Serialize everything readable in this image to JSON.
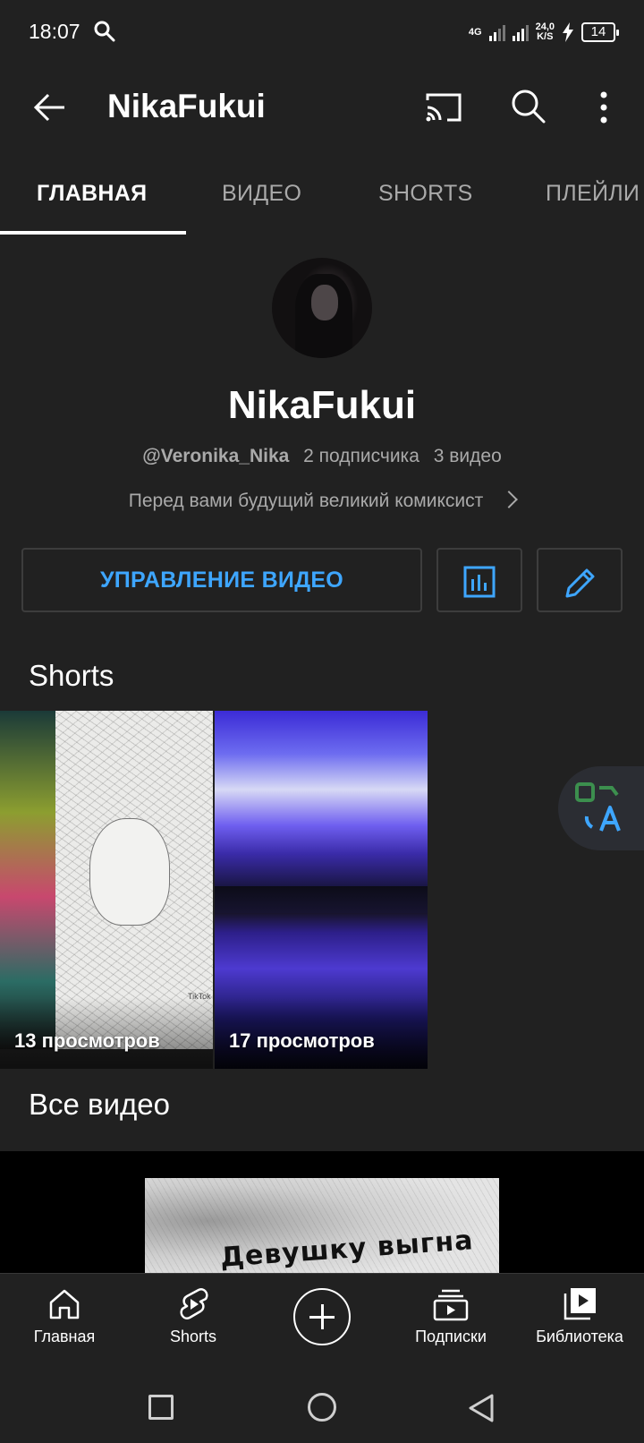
{
  "status_bar": {
    "time": "18:07",
    "network_type": "4G",
    "net_speed_value": "24,0",
    "net_speed_unit": "K/S",
    "battery": "14"
  },
  "app_bar": {
    "title": "NikaFukui",
    "icons": [
      "back-arrow-icon",
      "cast-icon",
      "search-icon",
      "more-vert-icon"
    ]
  },
  "tabs": [
    {
      "label": "ГЛАВНАЯ",
      "active": true
    },
    {
      "label": "ВИДЕО",
      "active": false
    },
    {
      "label": "SHORTS",
      "active": false
    },
    {
      "label": "ПЛЕЙЛИ",
      "active": false
    }
  ],
  "channel": {
    "name": "NikaFukui",
    "handle": "@Veronika_Nika",
    "subscribers": "2 подписчика",
    "videos": "3 видео",
    "description": "Перед вами будущий великий комиксист"
  },
  "actions": {
    "manage_label": "УПРАВЛЕНИЕ ВИДЕО",
    "accent_color": "#3ea6ff",
    "icons": [
      "analytics-icon",
      "edit-pencil-icon"
    ]
  },
  "shorts_section": {
    "title": "Shorts",
    "items": [
      {
        "views": "13 просмотров",
        "thumb_text": "TikTok"
      },
      {
        "views": "17 просмотров"
      }
    ]
  },
  "all_videos": {
    "title": "Все видео",
    "preview_caption": "Девушку выгна"
  },
  "bottom_nav": [
    {
      "label": "Главная",
      "icon": "home-icon"
    },
    {
      "label": "Shorts",
      "icon": "shorts-icon"
    },
    {
      "label": "",
      "icon": "create-plus-icon"
    },
    {
      "label": "Подписки",
      "icon": "subscriptions-icon"
    },
    {
      "label": "Библиотека",
      "icon": "library-icon"
    }
  ],
  "theme": {
    "background": "#212121",
    "text_primary": "#ffffff",
    "text_secondary": "#aaaaaa"
  }
}
